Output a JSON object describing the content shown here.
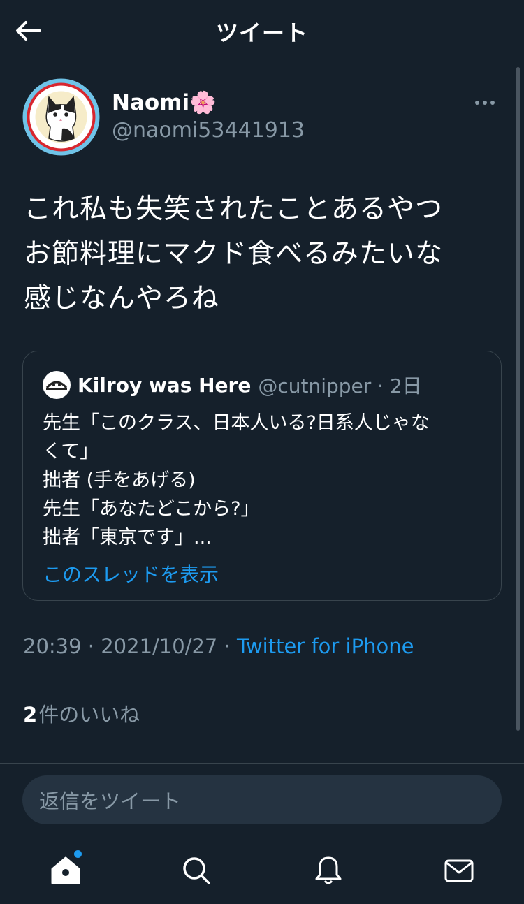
{
  "header": {
    "title": "ツイート"
  },
  "tweet": {
    "author": {
      "name": "Naomi🌸",
      "handle": "@naomi53441913"
    },
    "text_lines": [
      "これ私も失笑されたことあるやつ",
      "お節料理にマクド食べるみたいな",
      "感じなんやろね"
    ],
    "quoted": {
      "name": "Kilroy was Here",
      "meta": "@cutnipper · 2日",
      "lines": [
        "先生「このクラス、日本人いる?日系人じゃな",
        "くて」",
        "拙者 (手をあげる)",
        "先生「あなたどこから?」",
        "拙者「東京です」..."
      ],
      "show_thread": "このスレッドを表示"
    },
    "timestamp": "20:39 · 2021/10/27 · ",
    "source": "Twitter for iPhone",
    "likes_count": "2",
    "likes_label": "件のいいね"
  },
  "reply": {
    "placeholder": "返信をツイート"
  },
  "colors": {
    "background": "#15202b",
    "accent": "#1d9bf0",
    "muted": "#8899a6",
    "border": "#38444d"
  },
  "tabs": [
    {
      "icon": "home-icon",
      "notification_dot": true
    },
    {
      "icon": "search-icon"
    },
    {
      "icon": "bell-icon"
    },
    {
      "icon": "mail-icon"
    }
  ]
}
